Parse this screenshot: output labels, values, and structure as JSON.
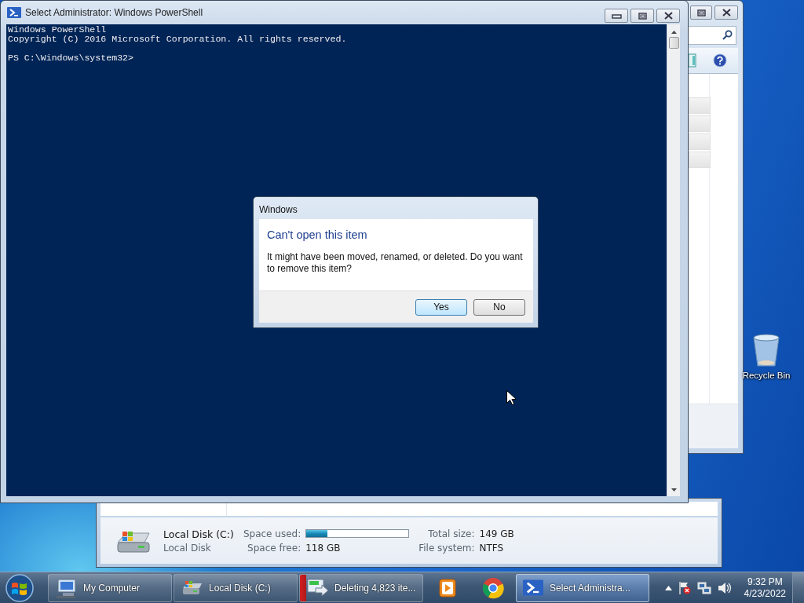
{
  "desktop": {
    "icons": [
      {
        "label": "Recycle Bin"
      }
    ]
  },
  "explorer": {
    "details": {
      "name": "Local Disk (C:)",
      "type": "Local Disk",
      "fields": [
        {
          "label": "Space used:",
          "kind": "bar",
          "level": 0.21
        },
        {
          "label": "Total size:",
          "kind": "text",
          "value": "149 GB"
        },
        {
          "label": "Space free:",
          "kind": "text",
          "value": "118 GB"
        },
        {
          "label": "File system:",
          "kind": "text",
          "value": "NTFS"
        }
      ]
    }
  },
  "powershell": {
    "title": "Select Administrator: Windows PowerShell",
    "console_blocks": [
      [
        "Windows PowerShell",
        "Copyright (C) 2016 Microsoft Corporation. All rights reserved."
      ],
      [
        "PS C:\\Windows\\system32>"
      ]
    ]
  },
  "dialog": {
    "title": "Windows",
    "heading": "Can't open this item",
    "message": "It might have been moved, renamed, or deleted. Do you want to remove this item?",
    "buttons": [
      {
        "label": "Yes",
        "default": true
      },
      {
        "label": "No",
        "default": false
      }
    ]
  },
  "taskbar": {
    "items": [
      {
        "kind": "computer",
        "label": "My Computer",
        "selected": false
      },
      {
        "kind": "drive",
        "label": "Local Disk (C:)",
        "selected": false
      },
      {
        "kind": "transfer",
        "label": "Deleting 4,823 ite...",
        "selected": false,
        "level": 0.05
      },
      {
        "kind": "media",
        "selected": false
      },
      {
        "kind": "browser",
        "selected": false
      },
      {
        "kind": "shell",
        "label": "Select Administra...",
        "selected": true
      }
    ],
    "clock": {
      "time": "9:32 PM",
      "date": "4/23/2022"
    }
  }
}
